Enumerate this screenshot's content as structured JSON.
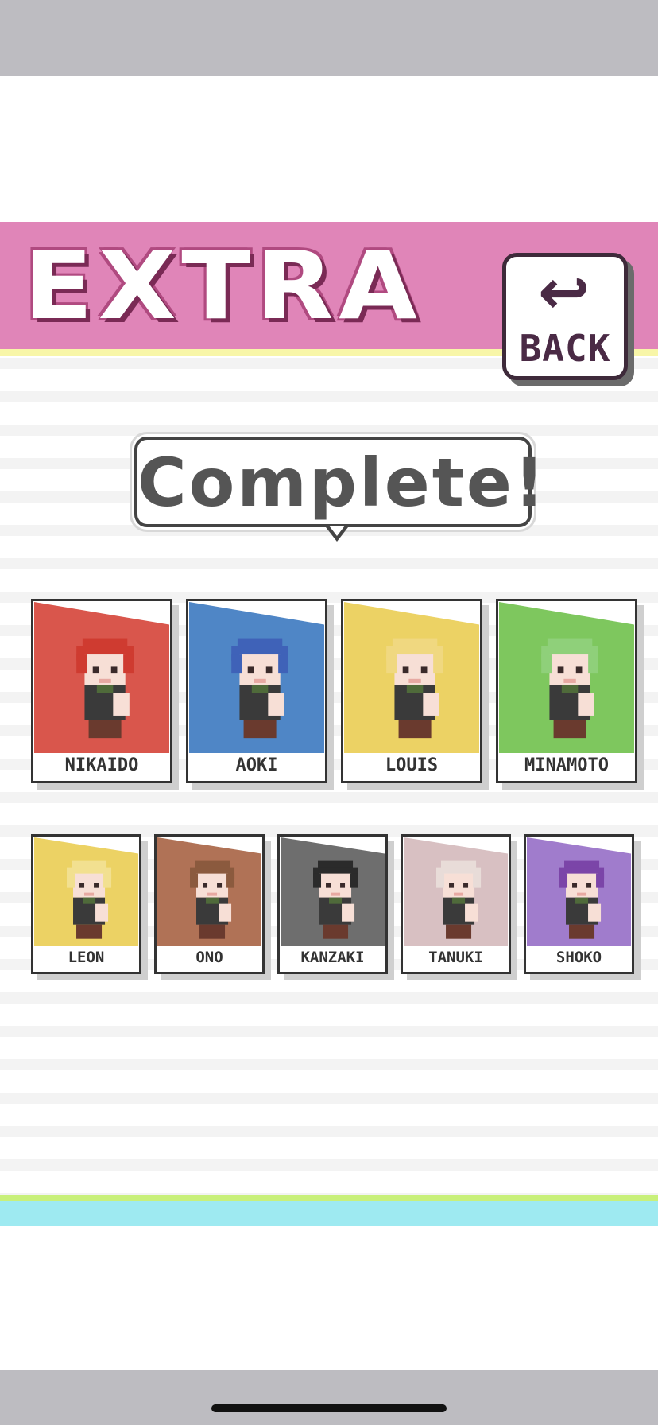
{
  "header": {
    "title": "EXTRA",
    "band_color": "#e085b8",
    "back_button": {
      "icon": "return-arrow-icon",
      "label": "BACK"
    }
  },
  "status_bubble": {
    "text": "Complete!"
  },
  "characters_row1": [
    {
      "name": "NIKAIDO",
      "color": "#d9564c",
      "hair": "#cf3b30"
    },
    {
      "name": "AOKI",
      "color": "#4f86c6",
      "hair": "#3f62b8"
    },
    {
      "name": "LOUIS",
      "color": "#ecd264",
      "hair": "#f0d880"
    },
    {
      "name": "MINAMOTO",
      "color": "#7ec75e",
      "hair": "#8fd07a"
    }
  ],
  "characters_row2": [
    {
      "name": "LEON",
      "color": "#ecd264",
      "hair": "#f2e090"
    },
    {
      "name": "ONO",
      "color": "#b07256",
      "hair": "#8b5a3e"
    },
    {
      "name": "KANZAKI",
      "color": "#6e6e6e",
      "hair": "#2b2b2b"
    },
    {
      "name": "TANUKI",
      "color": "#d8c0c2",
      "hair": "#e8dcd8"
    },
    {
      "name": "SHOKO",
      "color": "#a07ccc",
      "hair": "#7b45a8"
    }
  ]
}
